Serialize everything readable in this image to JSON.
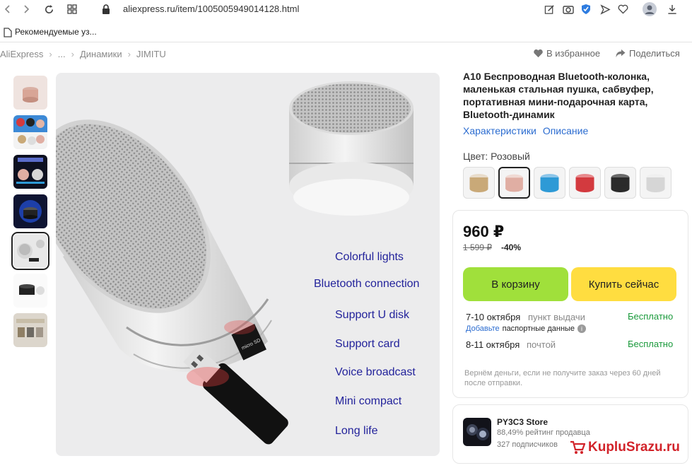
{
  "browser": {
    "url": "aliexpress.ru/item/1005005949014128.html",
    "bookmark": "Рекомендуемые уз..."
  },
  "breadcrumb": [
    "AliExpress",
    "...",
    "Динамики",
    "JIMITU"
  ],
  "actions": {
    "favorite": "В избранное",
    "share": "Поделиться"
  },
  "gallery": {
    "features": [
      "Colorful lights",
      "Bluetooth connection",
      "Support U disk",
      "Support card",
      "Voice broadcast",
      "Mini compact",
      "Long life"
    ],
    "card_label": "micro SD"
  },
  "product": {
    "title": "A10 Беспроводная Bluetooth-колонка, маленькая стальная пушка, сабвуфер, портативная мини-подарочная карта, Bluetooth-динамик",
    "tabs": [
      "Характеристики",
      "Описание"
    ],
    "color_label": "Цвет: Розовый",
    "swatch_colors": [
      "#c9a978",
      "#e0aea3",
      "#2e9ad6",
      "#d33a3f",
      "#2b2b2b",
      "#d6d6d6"
    ]
  },
  "pricing": {
    "price": "960 ₽",
    "old_price": "1 599 ₽",
    "discount": "-40%",
    "cart_button": "В корзину",
    "buy_button": "Купить сейчас"
  },
  "delivery": {
    "row1_date": "7-10 октября",
    "row1_method": "пункт выдачи",
    "row1_cost": "Бесплатно",
    "passport_link": "Добавьте",
    "passport_text": "паспортные данные",
    "row2_date": "8-11 октября",
    "row2_method": "почтой",
    "row2_cost": "Бесплатно",
    "refund": "Вернём деньги, если не получите заказ через 60 дней после отправки."
  },
  "store": {
    "name": "PY3C3 Store",
    "rating": "88,49% рейтинг продавца",
    "subscribers": "327 подписчиков"
  },
  "watermark": "KupluSrazu.ru",
  "colors": {
    "link": "#2b6cd0",
    "cart": "#a0e03b",
    "buy": "#ffdd40",
    "free": "#1b9a3c"
  }
}
